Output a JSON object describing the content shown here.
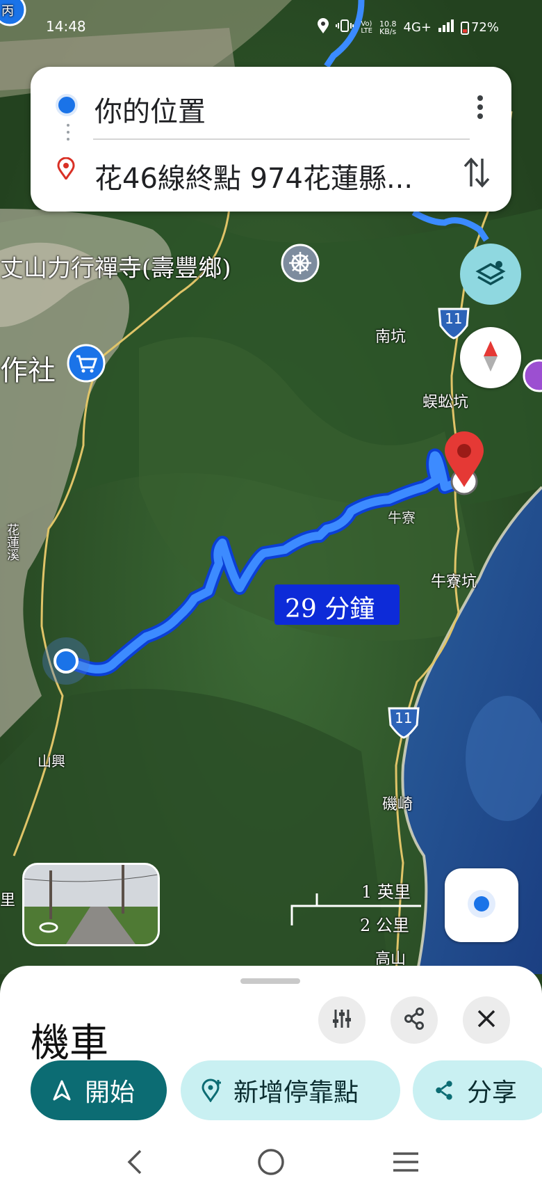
{
  "status_bar": {
    "time": "14:48",
    "speed": "10.8\nKB/s",
    "network": "4G+",
    "battery": "72%"
  },
  "search": {
    "origin": "你的位置",
    "destination": "花46線終點 974花蓮縣..."
  },
  "map": {
    "labels": {
      "temple": "丈山力行禪寺(壽豐鄉)",
      "coop": "作社",
      "nankeng": "南坑",
      "wugongkeng": "蜈蚣坑",
      "niuliaokeng": "牛寮坑",
      "shanxing": "山興",
      "jiqi": "磯崎",
      "gaoshan": "高山",
      "corner_top_left": "丙",
      "hualien_river": "花蓮溪",
      "li": "里",
      "niuliao_partial": "牛寮"
    },
    "route_eta": "29 分鐘",
    "highway_shield": "11",
    "scale": {
      "miles": "1 英里",
      "km": "2 公里"
    },
    "icons": {
      "layers": "layers-icon",
      "compass": "compass-icon",
      "my_location": "my-location-icon"
    },
    "colors": {
      "route": "#3d8bff",
      "route_outline": "#0b3fd6",
      "pin": "#e53935",
      "teal": "#0c6c73"
    }
  },
  "sheet": {
    "mode": "機車",
    "start": "開始",
    "add_stop": "新增停靠點",
    "share": "分享"
  }
}
